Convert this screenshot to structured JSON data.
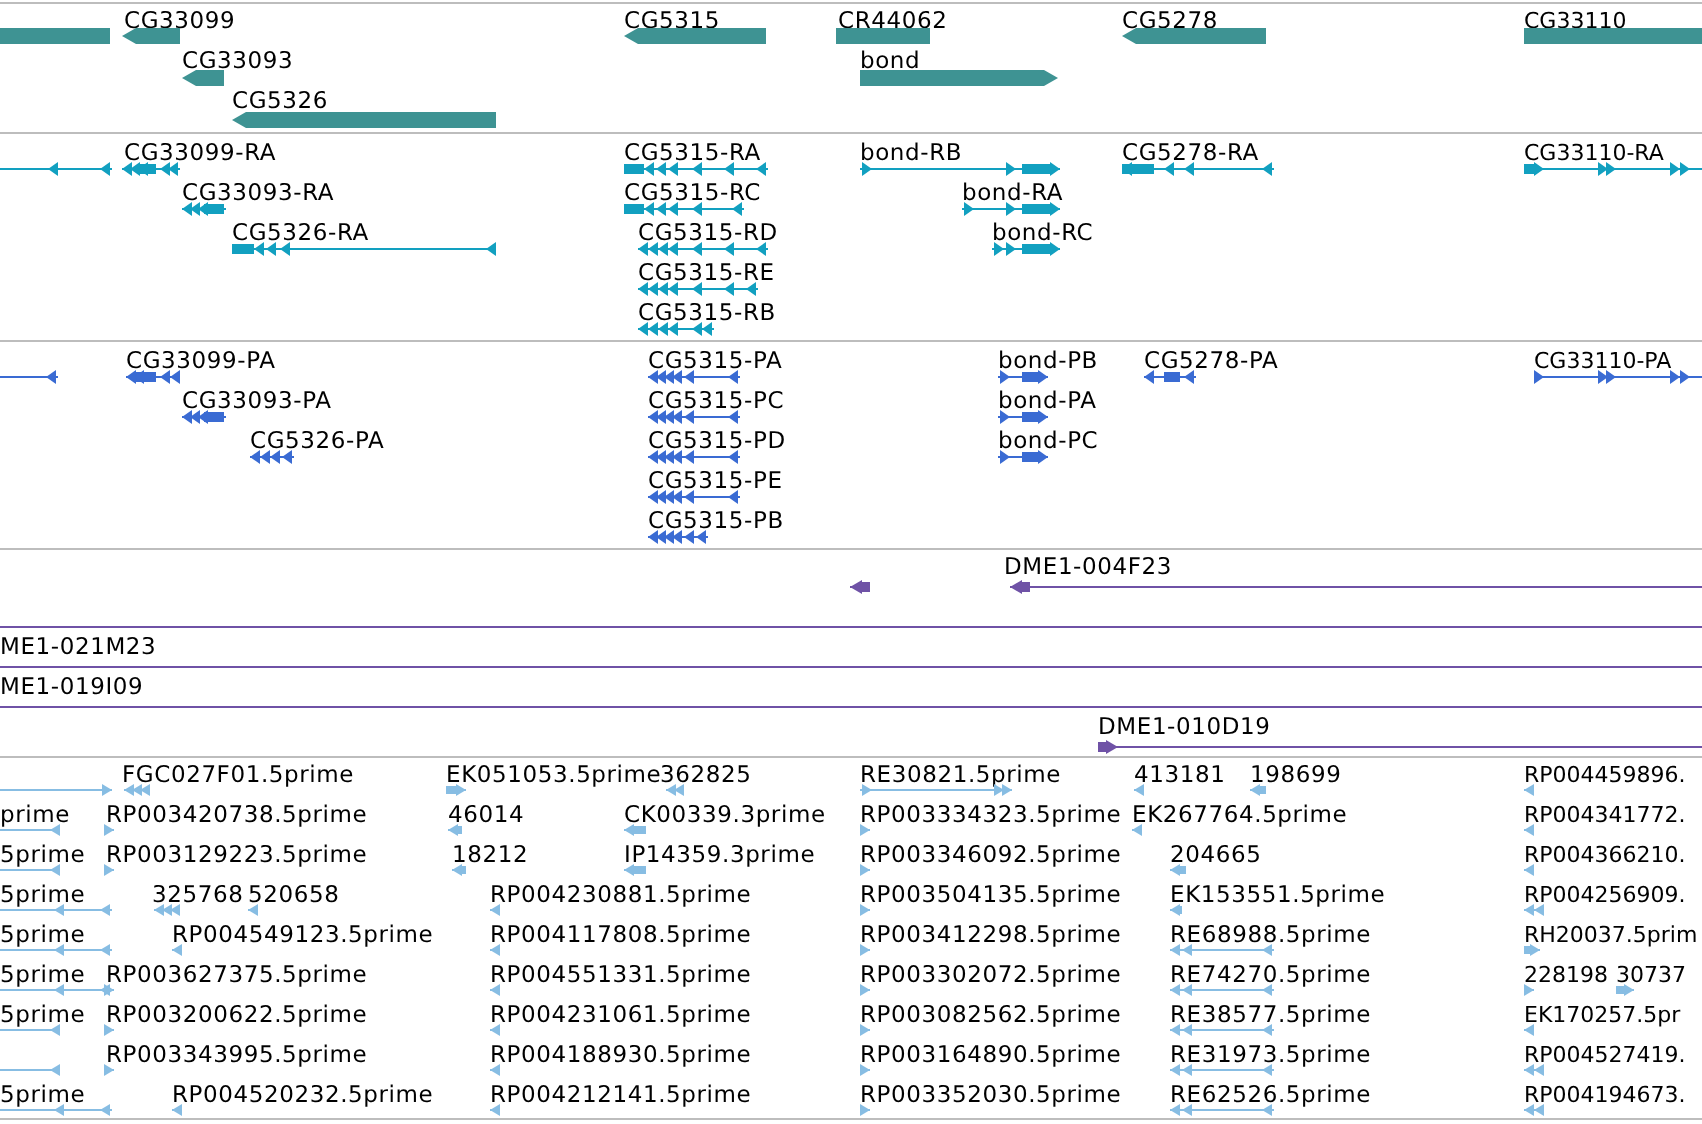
{
  "tracks": [
    {
      "kind": "gene",
      "color": "#3e9393",
      "features": [
        {
          "kind": "plain"
        },
        {
          "label": "CG33099",
          "kind": "reverse"
        },
        {
          "label": "CG33093",
          "kind": "reverse"
        },
        {
          "label": "CG5326",
          "kind": "reverse"
        },
        {
          "label": "CG5315",
          "kind": "reverse"
        },
        {
          "label": "CR44062",
          "kind": "plain"
        },
        {
          "label": "bond",
          "kind": "forward"
        },
        {
          "label": "CG5278",
          "kind": "reverse"
        },
        {
          "label": "CG33110",
          "kind": "plain"
        }
      ]
    },
    {
      "kind": "transcript",
      "color": "#12a0c0",
      "features": [
        {
          "kind": "reverse"
        },
        {
          "label": "CG33099-RA",
          "kind": "reverse"
        },
        {
          "label": "CG33093-RA",
          "kind": "reverse"
        },
        {
          "label": "CG5326-RA",
          "kind": "reverse"
        },
        {
          "label": "CG5315-RA",
          "kind": "reverse"
        },
        {
          "label": "CG5315-RC",
          "kind": "reverse"
        },
        {
          "label": "CG5315-RD",
          "kind": "reverse"
        },
        {
          "label": "CG5315-RE",
          "kind": "reverse"
        },
        {
          "label": "CG5315-RB",
          "kind": "reverse"
        },
        {
          "label": "bond-RB",
          "kind": "forward"
        },
        {
          "label": "bond-RA",
          "kind": "forward"
        },
        {
          "label": "bond-RC",
          "kind": "forward"
        },
        {
          "label": "CG5278-RA",
          "kind": "reverse"
        },
        {
          "label": "CG33110-RA",
          "kind": "forward"
        }
      ]
    },
    {
      "kind": "protein",
      "color": "#3a6bd3",
      "features": [
        {
          "kind": "reverse"
        },
        {
          "label": "CG33099-PA",
          "kind": "reverse"
        },
        {
          "label": "CG33093-PA",
          "kind": "reverse"
        },
        {
          "label": "CG5326-PA",
          "kind": "reverse"
        },
        {
          "label": "CG5315-PA",
          "kind": "reverse"
        },
        {
          "label": "CG5315-PC",
          "kind": "reverse"
        },
        {
          "label": "CG5315-PD",
          "kind": "reverse"
        },
        {
          "label": "CG5315-PE",
          "kind": "reverse"
        },
        {
          "label": "CG5315-PB",
          "kind": "reverse"
        },
        {
          "label": "bond-PB",
          "kind": "forward"
        },
        {
          "label": "bond-PA",
          "kind": "forward"
        },
        {
          "label": "bond-PC",
          "kind": "forward"
        },
        {
          "label": "CG5278-PA",
          "kind": "reverse"
        },
        {
          "label": "CG33110-PA",
          "kind": "forward"
        }
      ]
    },
    {
      "kind": "clone",
      "color": "#6f52a6",
      "features": [
        {
          "kind": "reverse"
        },
        {
          "label": "DME1-004F23",
          "kind": "reverse"
        },
        {
          "kind": "plain"
        },
        {
          "label": "ME1-021M23",
          "kind": "plain"
        },
        {
          "label": "ME1-019I09",
          "kind": "plain"
        },
        {
          "label": "DME1-010D19",
          "kind": "forward"
        }
      ]
    },
    {
      "kind": "est",
      "color": "#87bde3",
      "features": [
        {
          "kind": "forward"
        },
        {
          "label": "FGC027F01.5prime",
          "kind": "reverse"
        },
        {
          "label": "EK051053.5prime",
          "kind": "forward"
        },
        {
          "label": "362825",
          "kind": "reverse"
        },
        {
          "label": "RE30821.5prime",
          "kind": "forward"
        },
        {
          "label": "413181",
          "kind": "reverse"
        },
        {
          "label": "198699",
          "kind": "reverse"
        },
        {
          "label": "RP004459896.",
          "kind": "reverse"
        },
        {
          "label": "prime",
          "kind": "reverse"
        },
        {
          "label": "RP003420738.5prime",
          "kind": "forward"
        },
        {
          "label": "46014",
          "kind": "reverse"
        },
        {
          "label": "CK00339.3prime",
          "kind": "reverse"
        },
        {
          "label": "RP003334323.5prime",
          "kind": "forward"
        },
        {
          "label": "EK267764.5prime",
          "kind": "reverse"
        },
        {
          "label": "RP004341772.",
          "kind": "reverse"
        },
        {
          "label": "5prime",
          "kind": "reverse"
        },
        {
          "label": "RP003129223.5prime",
          "kind": "forward"
        },
        {
          "label": "18212",
          "kind": "reverse"
        },
        {
          "label": "IP14359.3prime",
          "kind": "reverse"
        },
        {
          "label": "RP003346092.5prime",
          "kind": "forward"
        },
        {
          "label": "204665",
          "kind": "reverse"
        },
        {
          "label": "RP004366210.",
          "kind": "reverse"
        },
        {
          "label": "5prime",
          "kind": "reverse"
        },
        {
          "label": "325768",
          "kind": "reverse"
        },
        {
          "label": "520658",
          "kind": "reverse"
        },
        {
          "label": "RP004230881.5prime",
          "kind": "reverse"
        },
        {
          "label": "RP003504135.5prime",
          "kind": "forward"
        },
        {
          "label": "EK153551.5prime",
          "kind": "reverse"
        },
        {
          "label": "RP004256909.",
          "kind": "reverse"
        },
        {
          "label": "5prime",
          "kind": "reverse"
        },
        {
          "label": "RP004549123.5prime",
          "kind": "reverse"
        },
        {
          "label": "RP004117808.5prime",
          "kind": "reverse"
        },
        {
          "label": "RP003412298.5prime",
          "kind": "forward"
        },
        {
          "label": "RE68988.5prime",
          "kind": "reverse"
        },
        {
          "label": "RH20037.5prim",
          "kind": "forward"
        },
        {
          "label": "5prime",
          "kind": "reverse"
        },
        {
          "label": "RP003627375.5prime",
          "kind": "forward"
        },
        {
          "label": "RP004551331.5prime",
          "kind": "reverse"
        },
        {
          "label": "RP003302072.5prime",
          "kind": "forward"
        },
        {
          "label": "RE74270.5prime",
          "kind": "reverse"
        },
        {
          "label": "228198",
          "kind": "forward"
        },
        {
          "label": "30737",
          "kind": "forward"
        },
        {
          "label": "5prime",
          "kind": "reverse"
        },
        {
          "label": "RP003200622.5prime",
          "kind": "forward"
        },
        {
          "label": "RP004231061.5prime",
          "kind": "reverse"
        },
        {
          "label": "RP003082562.5prime",
          "kind": "forward"
        },
        {
          "label": "RE38577.5prime",
          "kind": "reverse"
        },
        {
          "label": "EK170257.5pr",
          "kind": "reverse"
        },
        {
          "kind": "reverse"
        },
        {
          "label": "RP003343995.5prime",
          "kind": "forward"
        },
        {
          "label": "RP004188930.5prime",
          "kind": "reverse"
        },
        {
          "label": "RP003164890.5prime",
          "kind": "forward"
        },
        {
          "label": "RE31973.5prime",
          "kind": "reverse"
        },
        {
          "label": "RP004527419.",
          "kind": "reverse"
        },
        {
          "label": "5prime",
          "kind": "reverse"
        },
        {
          "label": "RP004520232.5prime",
          "kind": "reverse"
        },
        {
          "label": "RP004212141.5prime",
          "kind": "reverse"
        },
        {
          "label": "RP003352030.5prime",
          "kind": "forward"
        },
        {
          "label": "RE62526.5prime",
          "kind": "reverse"
        },
        {
          "label": "RP004194673.",
          "kind": "reverse"
        }
      ]
    }
  ]
}
